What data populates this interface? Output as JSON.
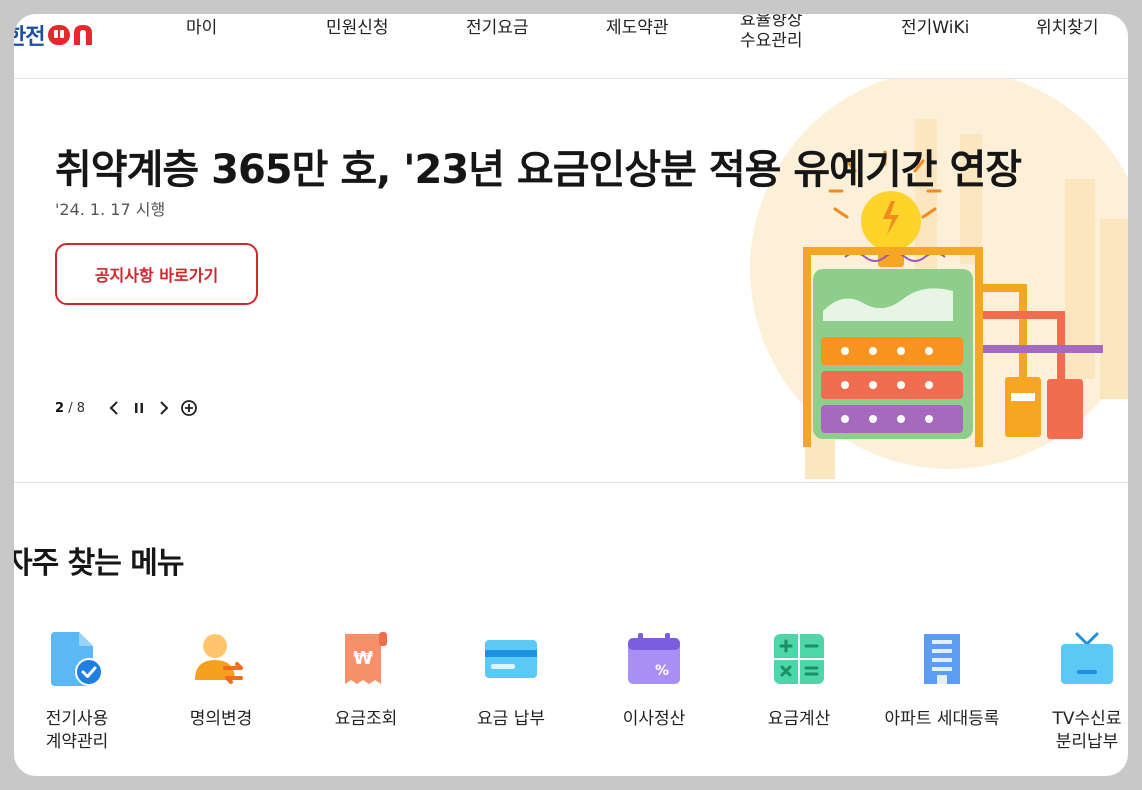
{
  "header": {
    "logo": {
      "text": "한전",
      "brand_color": "#1c4fa1",
      "on_color": "#e8262c"
    },
    "nav": [
      {
        "label": "마이"
      },
      {
        "label": "민원신청"
      },
      {
        "label": "전기요금"
      },
      {
        "label": "제도약관"
      },
      {
        "label": "효율향상\n수요관리"
      },
      {
        "label": "전기WiKi"
      },
      {
        "label": "위치찾기"
      }
    ]
  },
  "hero": {
    "title": "취약계층 365만 호, '23년 요금인상분 적용 유예기간 연장",
    "date": "'24. 1. 17 시행",
    "button_label": "공지사항 바로가기",
    "pager": {
      "current": "2",
      "separator": "/",
      "total": "8"
    },
    "controls": [
      "prev-icon",
      "pause-icon",
      "next-icon",
      "expand-icon"
    ]
  },
  "menu": {
    "title": "자주 찾는 메뉴",
    "items": [
      {
        "label": "전기사용\n계약관리",
        "icon": "contract-check-icon"
      },
      {
        "label": "명의변경",
        "icon": "user-change-icon"
      },
      {
        "label": "요금조회",
        "icon": "won-receipt-icon"
      },
      {
        "label": "요금 납부",
        "icon": "card-icon"
      },
      {
        "label": "이사정산",
        "icon": "calendar-percent-icon"
      },
      {
        "label": "요금계산",
        "icon": "calculator-icon"
      },
      {
        "label": "아파트 세대등록",
        "icon": "apartment-icon"
      },
      {
        "label": "TV수신료\n분리납부",
        "icon": "tv-icon"
      }
    ]
  },
  "colors": {
    "accent_red": "#d0262c",
    "blue": "#1c4fa1",
    "frame_bg": "#c8c8c8"
  }
}
